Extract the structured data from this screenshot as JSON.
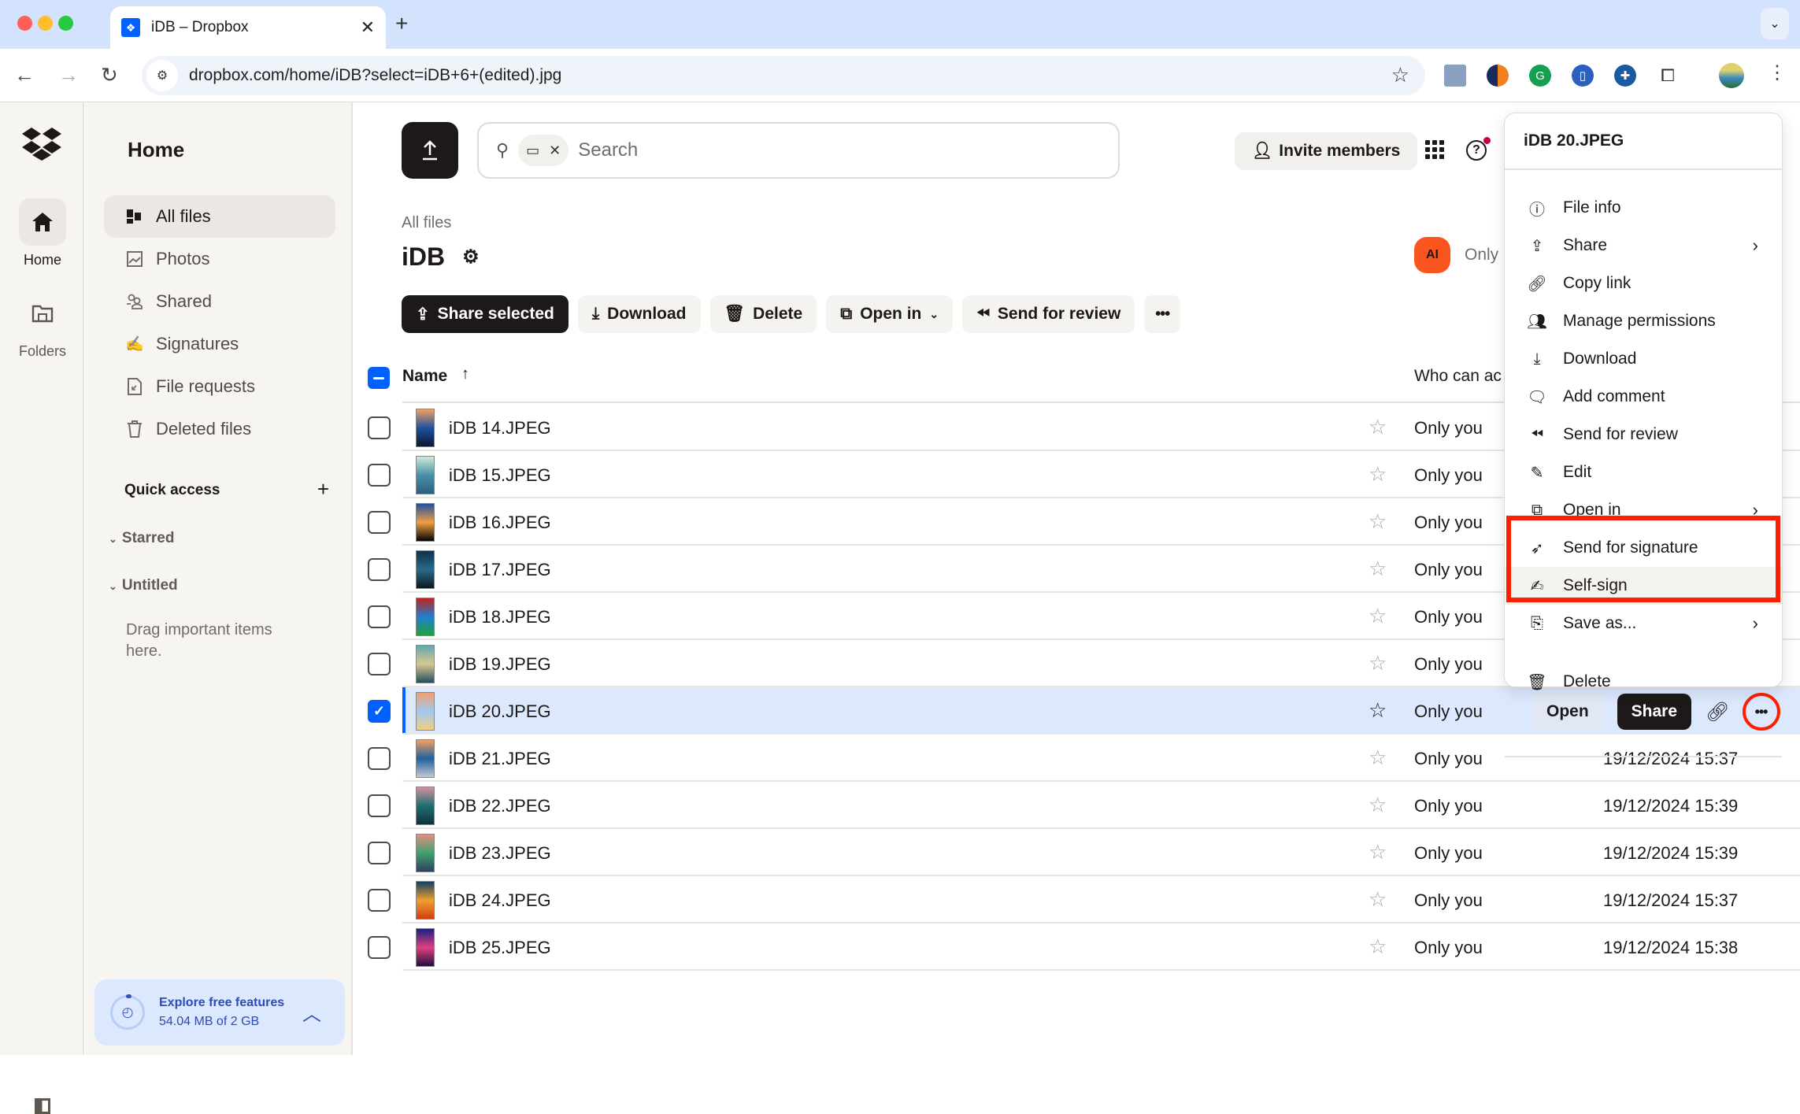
{
  "browser": {
    "tab_title": "iDB – Dropbox",
    "url": "dropbox.com/home/iDB?select=iDB+6+(edited).jpg",
    "extensions": [
      "image-extension-icon",
      "swirl-extension-icon",
      "grammarly-extension-icon",
      "document-extension-icon",
      "plus-circle-extension-icon",
      "puzzle-extensions-icon",
      "profile-avatar"
    ]
  },
  "rail": {
    "items": [
      {
        "label": "Home",
        "icon": "home-icon",
        "active": true
      },
      {
        "label": "Folders",
        "icon": "folders-icon",
        "active": false
      }
    ]
  },
  "sidebar": {
    "title": "Home",
    "items": [
      {
        "label": "All files",
        "icon": "all-files-icon",
        "active": true
      },
      {
        "label": "Photos",
        "icon": "photos-icon"
      },
      {
        "label": "Shared",
        "icon": "shared-icon"
      },
      {
        "label": "Signatures",
        "icon": "signatures-icon"
      },
      {
        "label": "File requests",
        "icon": "file-requests-icon"
      },
      {
        "label": "Deleted files",
        "icon": "trash-icon"
      }
    ],
    "quick_access": "Quick access",
    "groups": [
      "Starred",
      "Untitled"
    ],
    "drag_hint": "Drag important items here.",
    "storage": {
      "title": "Explore free features",
      "usage": "54.04 MB of 2 GB",
      "used_fraction": 0.027
    }
  },
  "topbar": {
    "search_placeholder": "Search",
    "invite_label": "Invite members"
  },
  "folder": {
    "breadcrumb": "All files",
    "title": "iDB",
    "owner_initials": "AI",
    "owner_access": "Only"
  },
  "actions": {
    "share_selected": "Share selected",
    "download": "Download",
    "delete": "Delete",
    "open_in": "Open in",
    "send_for_review": "Send for review"
  },
  "table": {
    "columns": {
      "name": "Name",
      "who": "Who can ac"
    },
    "rows": [
      {
        "name": "iDB 14.JPEG",
        "access": "Only you",
        "modified": "",
        "selected": false,
        "thumb": [
          "#f0a060",
          "#2050a0",
          "#0a1830"
        ]
      },
      {
        "name": "iDB 15.JPEG",
        "access": "Only you",
        "modified": "",
        "selected": false,
        "thumb": [
          "#d0e8d8",
          "#4a90a8",
          "#2a6080"
        ]
      },
      {
        "name": "iDB 16.JPEG",
        "access": "Only you",
        "modified": "",
        "selected": false,
        "thumb": [
          "#2050a0",
          "#f0a040",
          "#050505"
        ]
      },
      {
        "name": "iDB 17.JPEG",
        "access": "Only you",
        "modified": "",
        "selected": false,
        "thumb": [
          "#10304a",
          "#2a6a8a",
          "#0a1a20"
        ]
      },
      {
        "name": "iDB 18.JPEG",
        "access": "Only you",
        "modified": "",
        "selected": false,
        "thumb": [
          "#c02020",
          "#2080d0",
          "#20a040"
        ]
      },
      {
        "name": "iDB 19.JPEG",
        "access": "Only you",
        "modified": "",
        "selected": false,
        "thumb": [
          "#60a8b0",
          "#d8c890",
          "#205060"
        ]
      },
      {
        "name": "iDB 20.JPEG",
        "access": "Only you",
        "modified": "",
        "selected": true,
        "thumb": [
          "#f0a070",
          "#a0c8f0",
          "#f0d080"
        ]
      },
      {
        "name": "iDB 21.JPEG",
        "access": "Only you",
        "modified": "19/12/2024 15:37",
        "selected": false,
        "thumb": [
          "#f0a060",
          "#2060a0",
          "#c0c8d0"
        ]
      },
      {
        "name": "iDB 22.JPEG",
        "access": "Only you",
        "modified": "19/12/2024 15:39",
        "selected": false,
        "thumb": [
          "#d090a0",
          "#207070",
          "#103040"
        ]
      },
      {
        "name": "iDB 23.JPEG",
        "access": "Only you",
        "modified": "19/12/2024 15:39",
        "selected": false,
        "thumb": [
          "#e09080",
          "#40a070",
          "#304060"
        ]
      },
      {
        "name": "iDB 24.JPEG",
        "access": "Only you",
        "modified": "19/12/2024 15:37",
        "selected": false,
        "thumb": [
          "#104060",
          "#f0a030",
          "#d04010"
        ]
      },
      {
        "name": "iDB 25.JPEG",
        "access": "Only you",
        "modified": "19/12/2024 15:38",
        "selected": false,
        "thumb": [
          "#1a2080",
          "#e04080",
          "#201040"
        ]
      }
    ],
    "row_actions": {
      "open": "Open",
      "share": "Share"
    }
  },
  "context_menu": {
    "title": "iDB 20.JPEG",
    "items": [
      {
        "label": "File info",
        "icon": "info-icon",
        "glyph": "ⓘ",
        "submenu": false
      },
      {
        "label": "Share",
        "icon": "share-icon",
        "glyph": "⇪",
        "submenu": true
      },
      {
        "label": "Copy link",
        "icon": "link-icon",
        "glyph": "🔗︎",
        "submenu": false
      },
      {
        "label": "Manage permissions",
        "icon": "manage-permissions-icon",
        "glyph": "👥︎",
        "submenu": false
      },
      {
        "label": "Download",
        "icon": "download-icon",
        "glyph": "⤓",
        "submenu": false
      },
      {
        "label": "Add comment",
        "icon": "comment-icon",
        "glyph": "🗨︎",
        "submenu": false
      },
      {
        "label": "Send for review",
        "icon": "send-for-review-icon",
        "glyph": "⏪︎",
        "submenu": false
      },
      {
        "label": "Edit",
        "icon": "edit-pencil-icon",
        "glyph": "✎",
        "submenu": false
      },
      {
        "label": "Open in",
        "icon": "open-in-icon",
        "glyph": "⧉",
        "submenu": true
      },
      {
        "label": "Send for signature",
        "icon": "send-for-signature-icon",
        "glyph": "➶",
        "submenu": false,
        "highlighted_box": true
      },
      {
        "label": "Self-sign",
        "icon": "self-sign-icon",
        "glyph": "✍︎",
        "submenu": false,
        "highlighted_box": true,
        "hover": true
      },
      {
        "label": "Save as...",
        "icon": "save-as-icon",
        "glyph": "⎘",
        "submenu": true
      },
      {
        "label": "Delete",
        "icon": "trash-icon",
        "glyph": "🗑︎",
        "submenu": false
      }
    ]
  },
  "colors": {
    "accent": "#0061fe",
    "annotation_red": "#ff1f00",
    "selected_row": "#dbe8fd",
    "avatar": "#fa551e"
  }
}
